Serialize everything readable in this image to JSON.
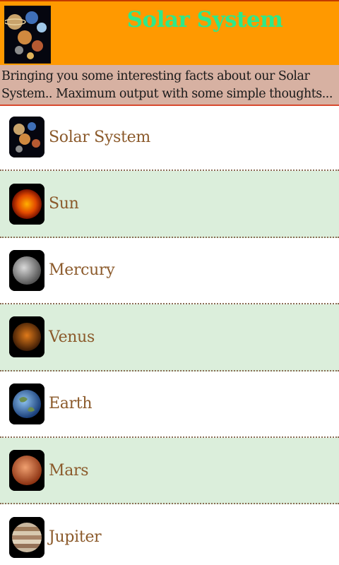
{
  "header": {
    "title": "Solar System",
    "logo_icon": "solar-system-logo-icon",
    "background": "#ff9900",
    "title_color": "#2ee88a"
  },
  "tagline": {
    "line1": "Bringing you some interesting facts about our Solar",
    "line2": "System.. Maximum output with some simple thoughts..."
  },
  "list": {
    "items": [
      {
        "label": "Solar System",
        "icon": "solar-system-icon"
      },
      {
        "label": "Sun",
        "icon": "sun-icon"
      },
      {
        "label": "Mercury",
        "icon": "mercury-icon"
      },
      {
        "label": "Venus",
        "icon": "venus-icon"
      },
      {
        "label": "Earth",
        "icon": "earth-icon"
      },
      {
        "label": "Mars",
        "icon": "mars-icon"
      },
      {
        "label": "Jupiter",
        "icon": "jupiter-icon"
      }
    ],
    "label_color": "#8b5a2b",
    "alt_row_color": "#dbeedb"
  }
}
